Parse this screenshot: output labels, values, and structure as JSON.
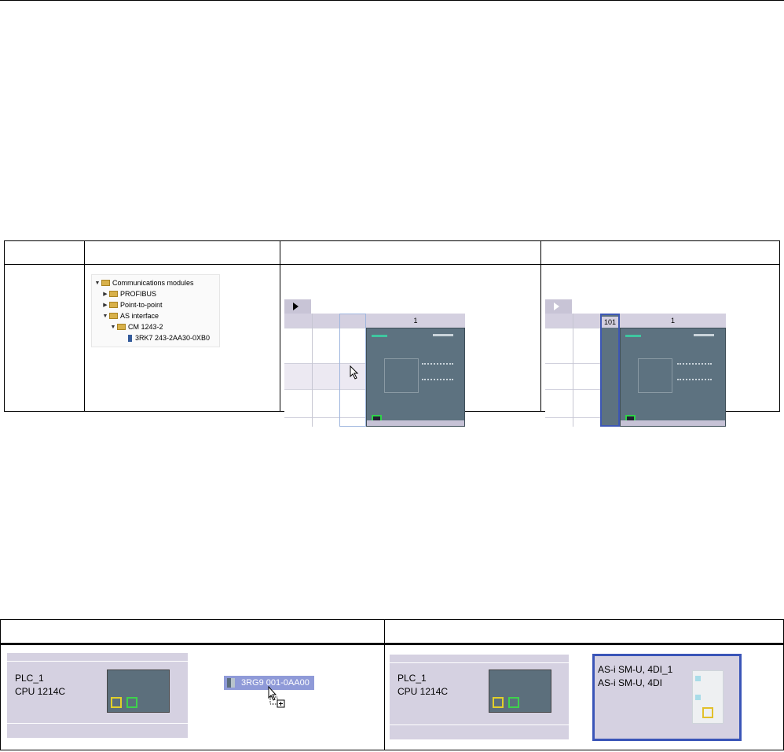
{
  "table1": {
    "headers": [
      "",
      "",
      "",
      ""
    ],
    "tree": {
      "items": [
        {
          "label": "Communications modules",
          "level": 0,
          "expanded": true,
          "icon": "folder-icon"
        },
        {
          "label": "PROFIBUS",
          "level": 1,
          "expanded": false,
          "icon": "folder-icon"
        },
        {
          "label": "Point-to-point",
          "level": 1,
          "expanded": false,
          "icon": "folder-icon"
        },
        {
          "label": "AS interface",
          "level": 1,
          "expanded": true,
          "icon": "folder-icon"
        },
        {
          "label": "CM 1243-2",
          "level": 2,
          "expanded": true,
          "icon": "folder-icon"
        },
        {
          "label": "3RK7 243-2AA30-0XB0",
          "level": 3,
          "expanded": null,
          "icon": "module-icon"
        }
      ]
    },
    "rack_before": {
      "slot_label": "1"
    },
    "rack_after": {
      "new_slot_label": "101",
      "slot_label": "1"
    }
  },
  "table2": {
    "headers": [
      "",
      ""
    ],
    "before": {
      "plc_name": "PLC_1",
      "cpu_type": "CPU 1214C",
      "drag_item": "3RG9 001-0AA00"
    },
    "after": {
      "plc_name": "PLC_1",
      "cpu_type": "CPU 1214C",
      "asi_name": "AS-i SM-U, 4DI_1",
      "asi_type": "AS-i SM-U, 4DI"
    }
  },
  "colors": {
    "accent_selection": "#3a55b8",
    "rack_header": "#d4d0e0",
    "cpu_body": "#5d7280",
    "network_bg": "#d5d1e1"
  }
}
